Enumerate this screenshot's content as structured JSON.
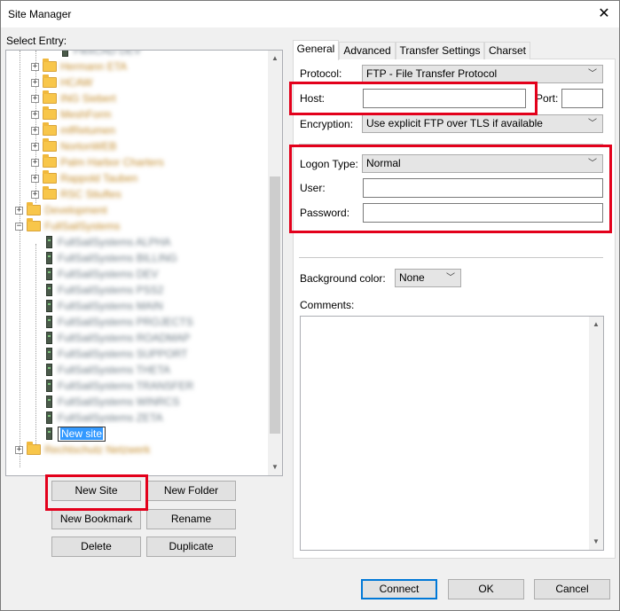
{
  "window": {
    "title": "Site Manager",
    "close_symbol": "✕"
  },
  "left": {
    "select_entry_label": "Select Entry:",
    "tree": {
      "items": [
        {
          "label": "FlexCAD DEV",
          "type": "server"
        },
        {
          "label": "Hermann ETA",
          "type": "folder"
        },
        {
          "label": "HCAW",
          "type": "folder"
        },
        {
          "label": "ING Siebert",
          "type": "folder"
        },
        {
          "label": "MeshForm",
          "type": "folder"
        },
        {
          "label": "mfRetumen",
          "type": "folder"
        },
        {
          "label": "NortonWEB",
          "type": "folder"
        },
        {
          "label": "Palm Harbor Charters",
          "type": "folder"
        },
        {
          "label": "Rappold Tauben",
          "type": "folder"
        },
        {
          "label": "RSC Stiuftes",
          "type": "folder"
        },
        {
          "label": "Development",
          "type": "folder"
        },
        {
          "label": "FullSailSystems",
          "type": "folder"
        },
        {
          "label": "FullSailSystems ALPHA",
          "type": "server"
        },
        {
          "label": "FullSailSystems BILLING",
          "type": "server"
        },
        {
          "label": "FullSailSystems DEV",
          "type": "server"
        },
        {
          "label": "FullSailSystems PSS2",
          "type": "server"
        },
        {
          "label": "FullSailSystems MAIN",
          "type": "server"
        },
        {
          "label": "FullSailSystems PROJECTS",
          "type": "server"
        },
        {
          "label": "FullSailSystems ROADMAP",
          "type": "server"
        },
        {
          "label": "FullSailSystems SUPPORT",
          "type": "server"
        },
        {
          "label": "FullSailSystems THETA",
          "type": "server"
        },
        {
          "label": "FullSailSystems TRANSFER",
          "type": "server"
        },
        {
          "label": "FullSailSystems WINRCS",
          "type": "server"
        },
        {
          "label": "FullSailSystems ZETA",
          "type": "server"
        },
        {
          "label": "Rechtschutz Netzwerk",
          "type": "folder"
        }
      ],
      "editing_label": "New site"
    },
    "buttons": {
      "new_site": "New Site",
      "new_folder": "New Folder",
      "new_bookmark": "New Bookmark",
      "rename": "Rename",
      "delete": "Delete",
      "duplicate": "Duplicate"
    }
  },
  "tabs": [
    {
      "label": "General",
      "active": true
    },
    {
      "label": "Advanced",
      "active": false
    },
    {
      "label": "Transfer Settings",
      "active": false
    },
    {
      "label": "Charset",
      "active": false
    }
  ],
  "general": {
    "protocol_label": "Protocol:",
    "protocol_value": "FTP - File Transfer Protocol",
    "host_label": "Host:",
    "host_value": "",
    "port_label": "Port:",
    "port_value": "",
    "encryption_label": "Encryption:",
    "encryption_value": "Use explicit FTP over TLS if available",
    "logon_type_label": "Logon Type:",
    "logon_type_value": "Normal",
    "user_label": "User:",
    "user_value": "",
    "password_label": "Password:",
    "password_value": "",
    "background_color_label": "Background color:",
    "background_color_value": "None",
    "comments_label": "Comments:",
    "comments_value": ""
  },
  "footer": {
    "connect": "Connect",
    "ok": "OK",
    "cancel": "Cancel"
  },
  "colors": {
    "highlight_red": "#e3001b",
    "accent_blue": "#0078d7",
    "selection_blue": "#3399ff"
  }
}
